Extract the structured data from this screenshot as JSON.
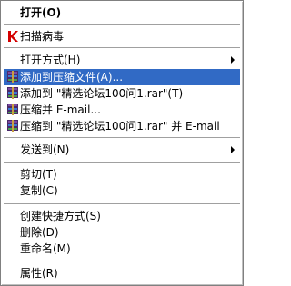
{
  "menu": {
    "open": "打开(O)",
    "scan": "扫描病毒",
    "open_with": "打开方式(H)",
    "add_archive": "添加到压缩文件(A)...",
    "add_named": "添加到 \"精选论坛100问1.rar\"(T)",
    "compress_email": "压缩并 E-mail...",
    "compress_named_email": "压缩到 \"精选论坛100问1.rar\" 并 E-mail",
    "send_to": "发送到(N)",
    "cut": "剪切(T)",
    "copy": "复制(C)",
    "create_shortcut": "创建快捷方式(S)",
    "delete": "删除(D)",
    "rename": "重命名(M)",
    "properties": "属性(R)"
  },
  "colors": {
    "highlight": "#316ac5",
    "kaspersky": "#d40000"
  },
  "icons": {
    "scan": "kaspersky-k-icon",
    "archive": "winrar-books-icon"
  }
}
